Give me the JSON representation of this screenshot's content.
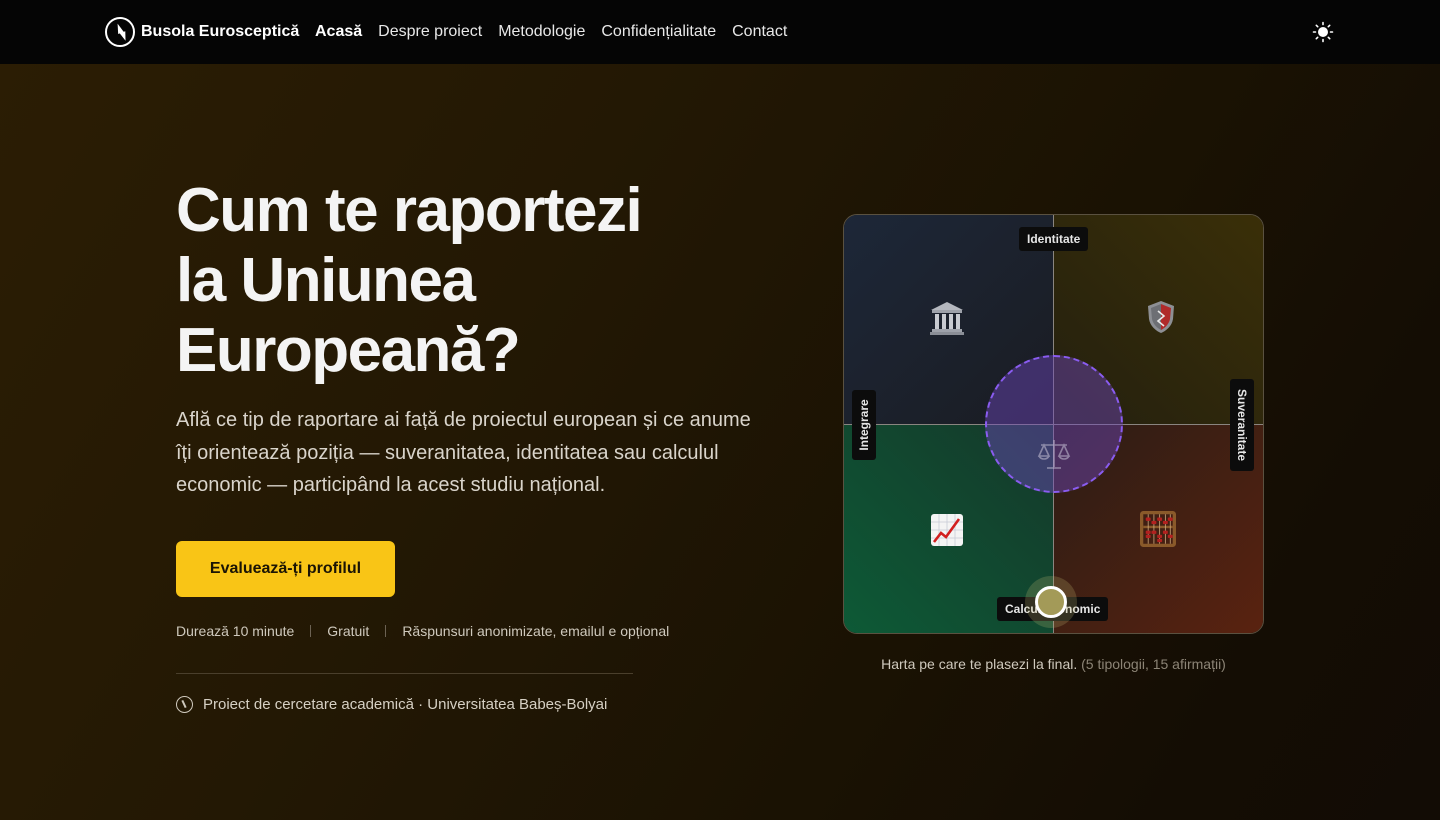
{
  "nav": {
    "brand": "Busola Eurosceptică",
    "links": [
      "Acasă",
      "Despre proiect",
      "Metodologie",
      "Confidențialitate",
      "Contact"
    ],
    "active_index": 0,
    "theme_icon": "sun-icon"
  },
  "hero": {
    "title_lines": [
      "Cum te raportezi",
      "la Uniunea",
      "Europeană?"
    ],
    "description": "Află ce tip de raportare ai față de proiectul european și ce anume îți orientează poziția — suveranitatea, identitatea sau calculul economic — participând la acest studiu național.",
    "cta_label": "Evaluează-ți profilul",
    "meta": [
      "Durează 10 minute",
      "Gratuit",
      "Răspunsuri anonimizate, emailul e opțional"
    ],
    "affiliation": "Proiect de cercetare academică · Universitatea Babeș-Bolyai"
  },
  "compass": {
    "axes": {
      "top": "Identitate",
      "bottom": "Calcul economic",
      "left": "Integrare",
      "right": "Suveranitate"
    },
    "quadrant_icons": {
      "top_left": "classical-building-icon",
      "top_right": "shield-icon",
      "bottom_left": "chart-increasing-icon",
      "bottom_right": "abacus-icon",
      "center": "balance-scale-icon"
    },
    "caption_main": "Harta pe care te plasezi la final.",
    "caption_muted": "(5 tipologii, 15 afirmații)",
    "colors": {
      "top_left": "#1d2738",
      "top_right": "#3a2f08",
      "bottom_left": "#0d5a36",
      "bottom_right": "#5a2210",
      "center": "#8a5cf0",
      "accent": "#f9c516"
    }
  }
}
